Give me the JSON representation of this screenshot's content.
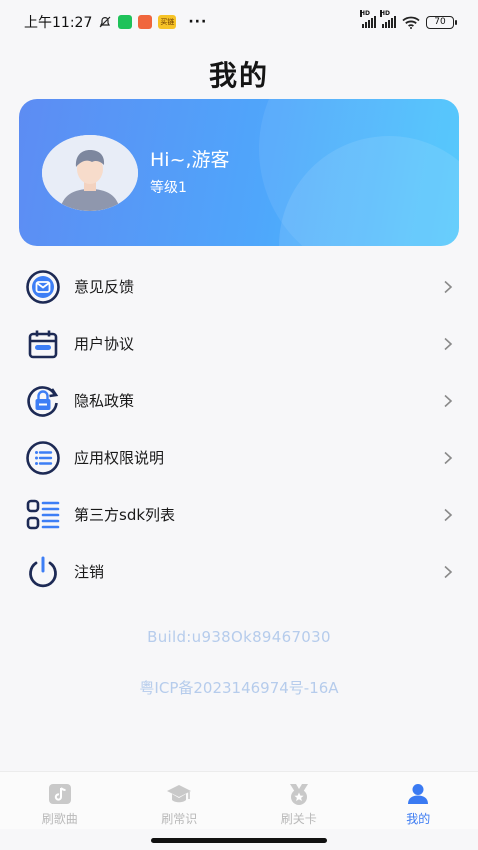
{
  "status_bar": {
    "time": "上午11:27",
    "yellow_app_text": "买链",
    "dots": "···",
    "signal_label_1": "HD",
    "signal_label_2": "HD",
    "battery": "70"
  },
  "page": {
    "title": "我的"
  },
  "profile": {
    "greeting": "Hi~,游客",
    "level": "等级1"
  },
  "menu": [
    {
      "label": "意见反馈",
      "icon": "mail-icon"
    },
    {
      "label": "用户协议",
      "icon": "calendar-icon"
    },
    {
      "label": "隐私政策",
      "icon": "lock-refresh-icon"
    },
    {
      "label": "应用权限说明",
      "icon": "list-circle-icon"
    },
    {
      "label": "第三方sdk列表",
      "icon": "grid-list-icon"
    },
    {
      "label": "注销",
      "icon": "power-icon"
    }
  ],
  "footer": {
    "build": "Build:u938Ok89467030",
    "icp": "粤ICP备2023146974号-16A"
  },
  "tabs": [
    {
      "label": "刷歌曲",
      "icon": "music-icon",
      "active": false
    },
    {
      "label": "刷常识",
      "icon": "graduation-cap-icon",
      "active": false
    },
    {
      "label": "刷关卡",
      "icon": "medal-icon",
      "active": false
    },
    {
      "label": "我的",
      "icon": "user-icon",
      "active": true
    }
  ],
  "colors": {
    "accent": "#3a7af2",
    "card_gradient_start": "#5d8cf3",
    "card_gradient_end": "#48c6fc",
    "menu_icon_navy": "#1d2a55",
    "menu_icon_blue": "#3d7ef5"
  }
}
